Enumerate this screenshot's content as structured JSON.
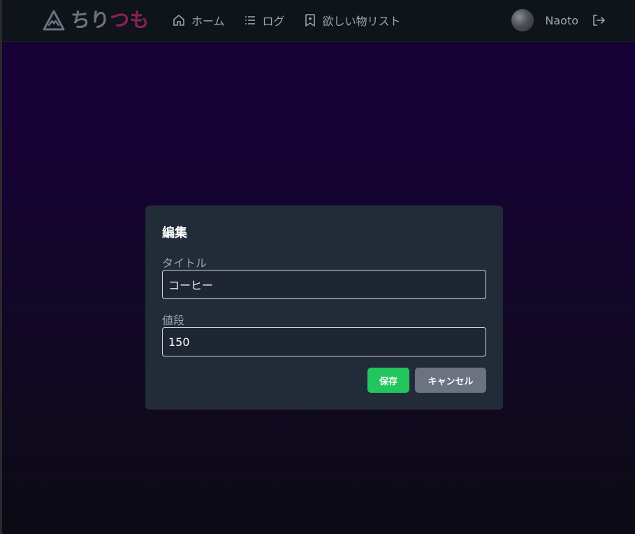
{
  "navbar": {
    "logo": {
      "part1": "ちり",
      "part2": "つも"
    },
    "items": [
      {
        "label": "ホーム",
        "icon": "home-icon"
      },
      {
        "label": "ログ",
        "icon": "list-icon"
      },
      {
        "label": "欲しい物リスト",
        "icon": "bookmark-heart-icon"
      }
    ],
    "user": {
      "name": "Naoto",
      "logout_icon": "logout-icon"
    }
  },
  "modal": {
    "title": "編集",
    "title_label": "タイトル",
    "title_value": "コーヒー",
    "price_label": "値段",
    "price_value": "150",
    "save_label": "保存",
    "cancel_label": "キャンセル"
  },
  "colors": {
    "accent_green": "#22c55e",
    "button_gray": "#6b7280",
    "logo_pink": "#8a1f5a",
    "modal_bg": "#222c39"
  }
}
